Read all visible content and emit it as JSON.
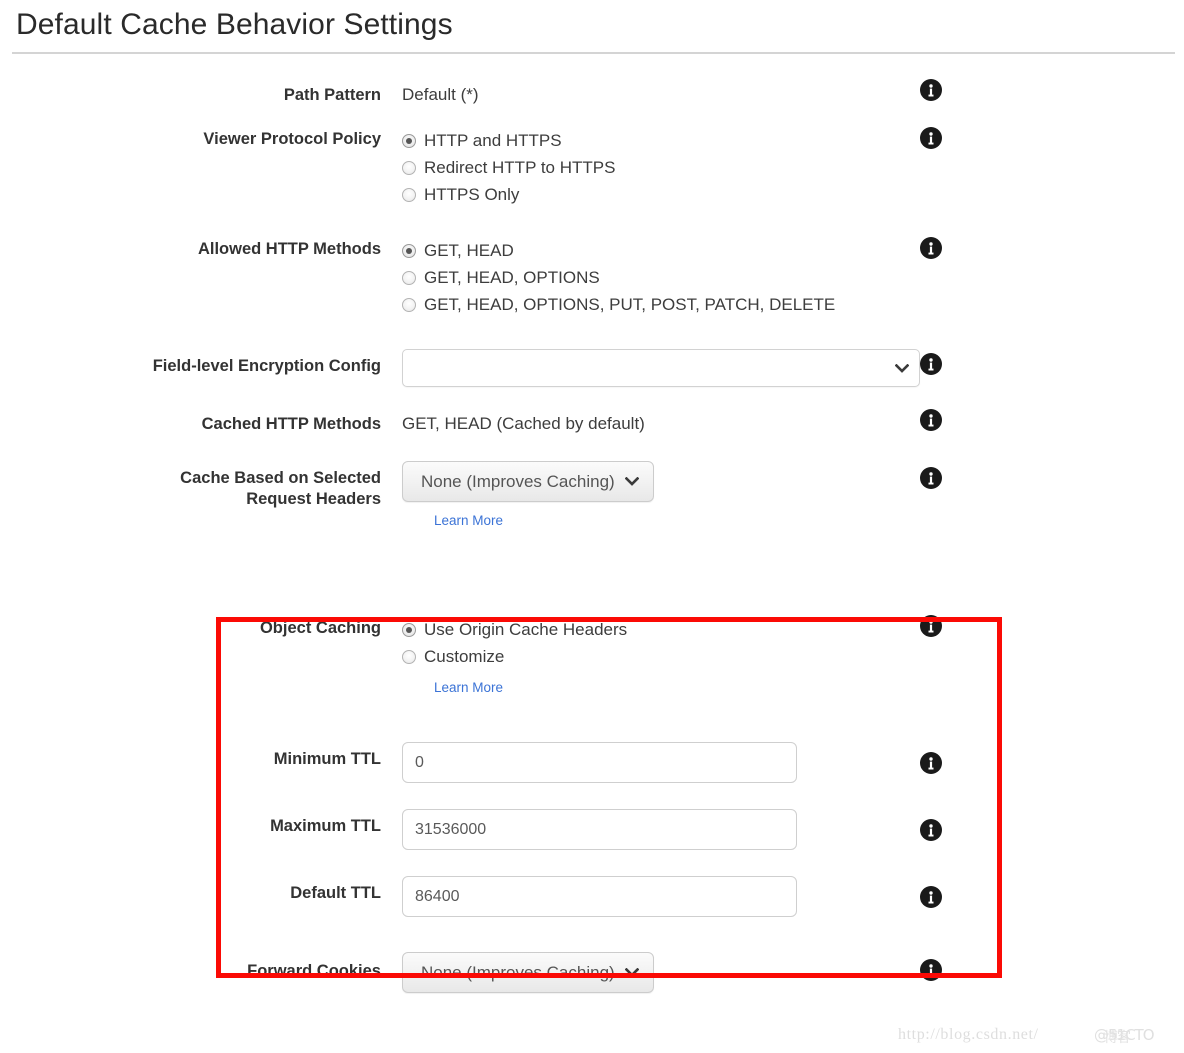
{
  "page": {
    "title": "Default Cache Behavior Settings",
    "watermark": "http://blog.csdn.net/",
    "watermark_overlay": "@51CTO",
    "watermark_overlay2": "博客",
    "accent_highlight_color": "#fb0a05",
    "link_color": "#3b73d6"
  },
  "fields": {
    "path_pattern": {
      "label": "Path Pattern",
      "value": "Default (*)",
      "info": "info-icon"
    },
    "viewer_protocol_policy": {
      "label": "Viewer Protocol Policy",
      "options": [
        {
          "label": "HTTP and HTTPS",
          "selected": true
        },
        {
          "label": "Redirect HTTP to HTTPS",
          "selected": false
        },
        {
          "label": "HTTPS Only",
          "selected": false
        }
      ],
      "info": "info-icon"
    },
    "allowed_http_methods": {
      "label": "Allowed HTTP Methods",
      "options": [
        {
          "label": "GET, HEAD",
          "selected": true
        },
        {
          "label": "GET, HEAD, OPTIONS",
          "selected": false
        },
        {
          "label": "GET, HEAD, OPTIONS, PUT, POST, PATCH, DELETE",
          "selected": false
        }
      ],
      "info": "info-icon"
    },
    "field_level_encryption_config": {
      "label": "Field-level Encryption Config",
      "value": "",
      "placeholder": "",
      "chevron": "chevron-down-icon",
      "info": "info-icon"
    },
    "cached_http_methods": {
      "label": "Cached HTTP Methods",
      "value": "GET, HEAD (Cached by default)",
      "info": "info-icon"
    },
    "cache_based_on_headers": {
      "label_line1": "Cache Based on Selected",
      "label_line2": "Request Headers",
      "value": "None (Improves Caching)",
      "learn_more": "Learn More",
      "chevron": "chevron-down-icon",
      "info": "info-icon"
    },
    "object_caching": {
      "label": "Object Caching",
      "options": [
        {
          "label": "Use Origin Cache Headers",
          "selected": true
        },
        {
          "label": "Customize",
          "selected": false
        }
      ],
      "learn_more": "Learn More",
      "info": "info-icon"
    },
    "minimum_ttl": {
      "label": "Minimum TTL",
      "value": "0",
      "info": "info-icon"
    },
    "maximum_ttl": {
      "label": "Maximum TTL",
      "value": "31536000",
      "info": "info-icon"
    },
    "default_ttl": {
      "label": "Default TTL",
      "value": "86400",
      "info": "info-icon"
    },
    "forward_cookies": {
      "label": "Forward Cookies",
      "value": "None (Improves Caching)",
      "chevron": "chevron-down-icon",
      "info": "info-icon"
    }
  }
}
